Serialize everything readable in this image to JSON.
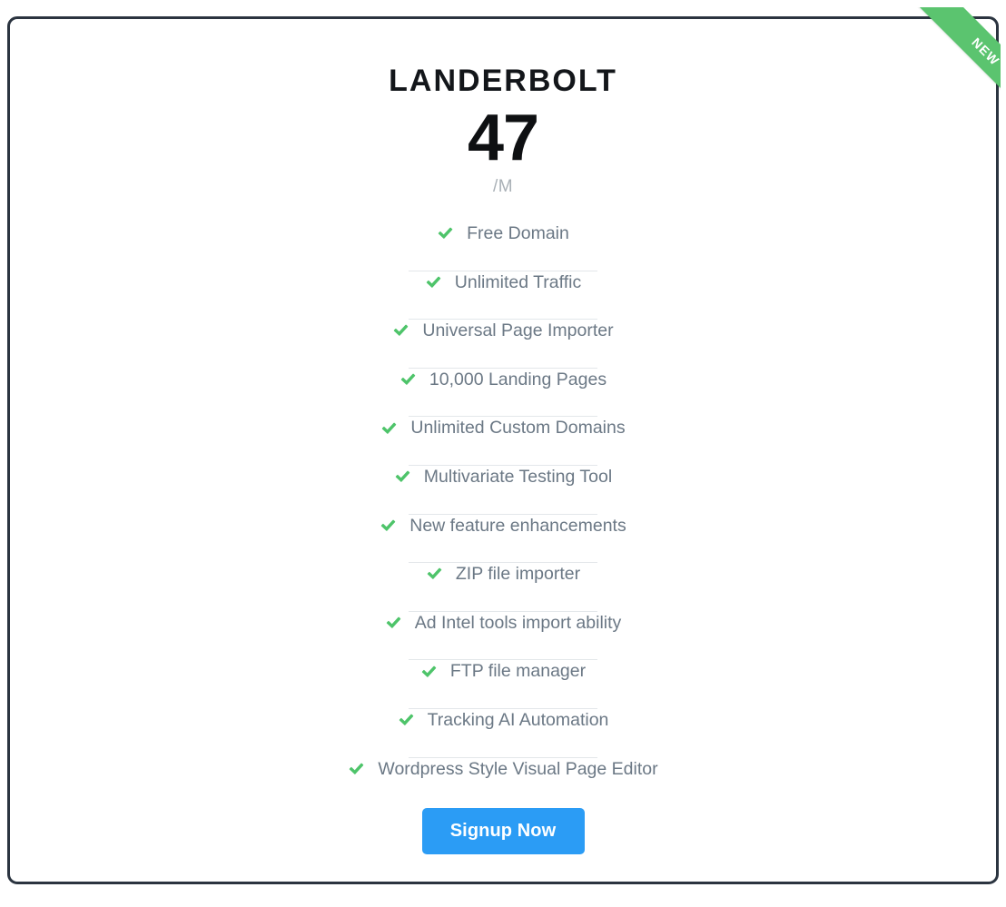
{
  "card": {
    "plan_name": "LANDERBOLT",
    "price": "47",
    "price_period": "/M",
    "ribbon_label": "NEW",
    "border_color": "#2b3440",
    "accent_green": "#5bc46f",
    "accent_blue": "#2b9cf5",
    "feature_text_color": "#6b7885"
  },
  "features": [
    {
      "label": "Free Domain",
      "icon": "check-icon"
    },
    {
      "label": "Unlimited Traffic",
      "icon": "check-icon"
    },
    {
      "label": "Universal Page Importer",
      "icon": "check-icon"
    },
    {
      "label": "10,000 Landing Pages",
      "icon": "check-icon"
    },
    {
      "label": "Unlimited Custom Domains",
      "icon": "check-icon"
    },
    {
      "label": "Multivariate Testing Tool",
      "icon": "check-icon"
    },
    {
      "label": "New feature enhancements",
      "icon": "check-icon"
    },
    {
      "label": "ZIP file importer",
      "icon": "check-icon"
    },
    {
      "label": "Ad Intel tools import ability",
      "icon": "check-icon"
    },
    {
      "label": "FTP file manager",
      "icon": "check-icon"
    },
    {
      "label": "Tracking AI Automation",
      "icon": "check-icon"
    },
    {
      "label": "Wordpress Style Visual Page Editor",
      "icon": "check-icon"
    }
  ],
  "cta": {
    "label": "Signup Now"
  }
}
